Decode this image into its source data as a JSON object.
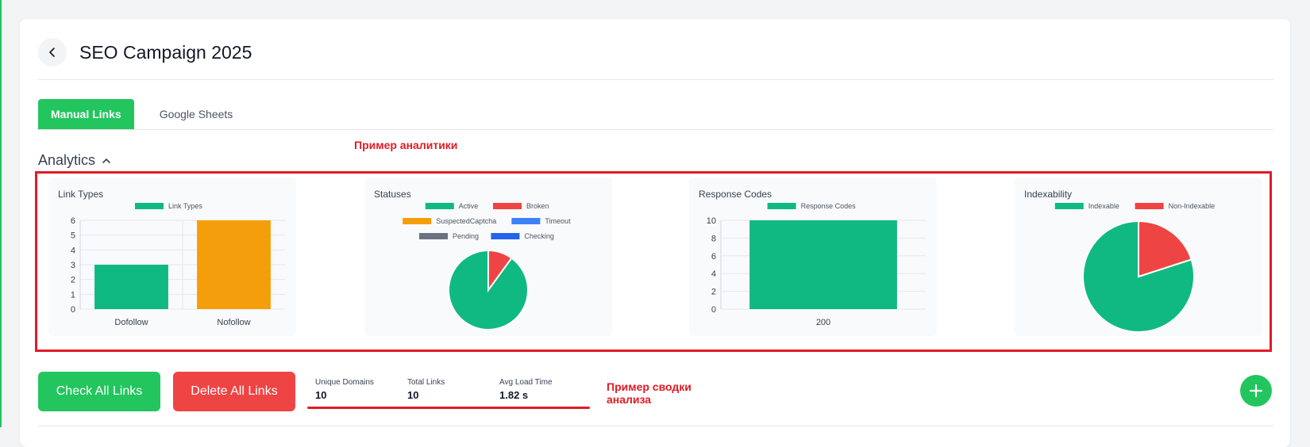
{
  "header": {
    "title": "SEO Campaign 2025"
  },
  "tabs": [
    {
      "label": "Manual Links",
      "active": true
    },
    {
      "label": "Google Sheets",
      "active": false
    }
  ],
  "analytics": {
    "title": "Analytics"
  },
  "annotations": {
    "analytics_example": "Пример аналитики",
    "summary_example_line1": "Пример сводки",
    "summary_example_line2": "анализа"
  },
  "colors": {
    "accent": "#22c55e",
    "danger": "#ef4444",
    "annotation": "#e01b24",
    "green": "#10b981",
    "orange": "#f59e0b",
    "red": "#ef4444",
    "blue": "#3b82f6",
    "gray": "#6b7280",
    "darkblue": "#2563eb"
  },
  "chart_data": [
    {
      "type": "bar",
      "title": "Link Types",
      "series": [
        {
          "name": "Link Types",
          "values": [
            3,
            6
          ]
        }
      ],
      "categories": [
        "Dofollow",
        "Nofollow"
      ],
      "bar_colors": [
        "#10b981",
        "#f59e0b"
      ],
      "ylim": [
        0,
        6
      ],
      "yticks": [
        "0",
        "1",
        "2",
        "3",
        "4",
        "5",
        "6"
      ],
      "grid": true,
      "legend": "top"
    },
    {
      "type": "pie",
      "title": "Statuses",
      "labels": [
        "Active",
        "Broken",
        "SuspectedCaptcha",
        "Timeout",
        "Pending",
        "Checking"
      ],
      "values": [
        9,
        1,
        0,
        0,
        0,
        0
      ],
      "colors": [
        "#10b981",
        "#ef4444",
        "#f59e0b",
        "#3b82f6",
        "#6b7280",
        "#2563eb"
      ],
      "legend": "top"
    },
    {
      "type": "bar",
      "title": "Response Codes",
      "series": [
        {
          "name": "Response Codes",
          "values": [
            10
          ]
        }
      ],
      "categories": [
        "200"
      ],
      "bar_colors": [
        "#10b981"
      ],
      "ylim": [
        0,
        10
      ],
      "yticks": [
        "0",
        "2",
        "4",
        "6",
        "8",
        "10"
      ],
      "grid": true,
      "legend": "top"
    },
    {
      "type": "pie",
      "title": "Indexability",
      "labels": [
        "Indexable",
        "Non-Indexable"
      ],
      "values": [
        8,
        2
      ],
      "colors": [
        "#10b981",
        "#ef4444"
      ],
      "legend": "top"
    }
  ],
  "actions": {
    "check_all": "Check All Links",
    "delete_all": "Delete All Links"
  },
  "summary": [
    {
      "label": "Unique Domains",
      "value": "10"
    },
    {
      "label": "Total Links",
      "value": "10"
    },
    {
      "label": "Avg Load Time",
      "value": "1.82 s"
    }
  ],
  "icons": {
    "back": "chevron-left-icon",
    "collapse": "chevron-up-icon",
    "add": "plus-icon"
  }
}
